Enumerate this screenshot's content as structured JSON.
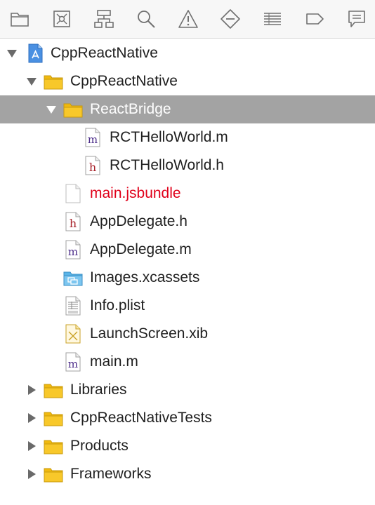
{
  "toolbar": {
    "buttons": [
      {
        "name": "project-navigator-icon"
      },
      {
        "name": "source-control-navigator-icon"
      },
      {
        "name": "symbol-navigator-icon"
      },
      {
        "name": "find-navigator-icon"
      },
      {
        "name": "issue-navigator-icon"
      },
      {
        "name": "test-navigator-icon"
      },
      {
        "name": "debug-navigator-icon"
      },
      {
        "name": "breakpoint-navigator-icon"
      },
      {
        "name": "report-navigator-icon"
      }
    ]
  },
  "tree": {
    "project": {
      "label": "CppReactNative",
      "icon": "xcode-project-icon",
      "expanded": true
    },
    "group_main": {
      "label": "CppReactNative",
      "icon": "folder-icon",
      "expanded": true
    },
    "group_bridge": {
      "label": "ReactBridge",
      "icon": "folder-icon",
      "expanded": true,
      "selected": true
    },
    "file_rct_m": {
      "label": "RCTHelloWorld.m",
      "icon": "objc-implementation-file-icon"
    },
    "file_rct_h": {
      "label": "RCTHelloWorld.h",
      "icon": "header-file-icon"
    },
    "file_jsbundle": {
      "label": "main.jsbundle",
      "icon": "blank-file-icon",
      "status_color": "#e0001a"
    },
    "file_appdelegate_h": {
      "label": "AppDelegate.h",
      "icon": "header-file-icon"
    },
    "file_appdelegate_m": {
      "label": "AppDelegate.m",
      "icon": "objc-implementation-file-icon"
    },
    "file_images": {
      "label": "Images.xcassets",
      "icon": "asset-catalog-icon"
    },
    "file_plist": {
      "label": "Info.plist",
      "icon": "plist-file-icon"
    },
    "file_launch": {
      "label": "LaunchScreen.xib",
      "icon": "xib-file-icon"
    },
    "file_main_m": {
      "label": "main.m",
      "icon": "objc-implementation-file-icon"
    },
    "group_libraries": {
      "label": "Libraries",
      "icon": "folder-icon",
      "expanded": false
    },
    "group_tests": {
      "label": "CppReactNativeTests",
      "icon": "folder-icon",
      "expanded": false
    },
    "group_products": {
      "label": "Products",
      "icon": "folder-icon",
      "expanded": false
    },
    "group_frameworks": {
      "label": "Frameworks",
      "icon": "folder-icon",
      "expanded": false
    }
  }
}
